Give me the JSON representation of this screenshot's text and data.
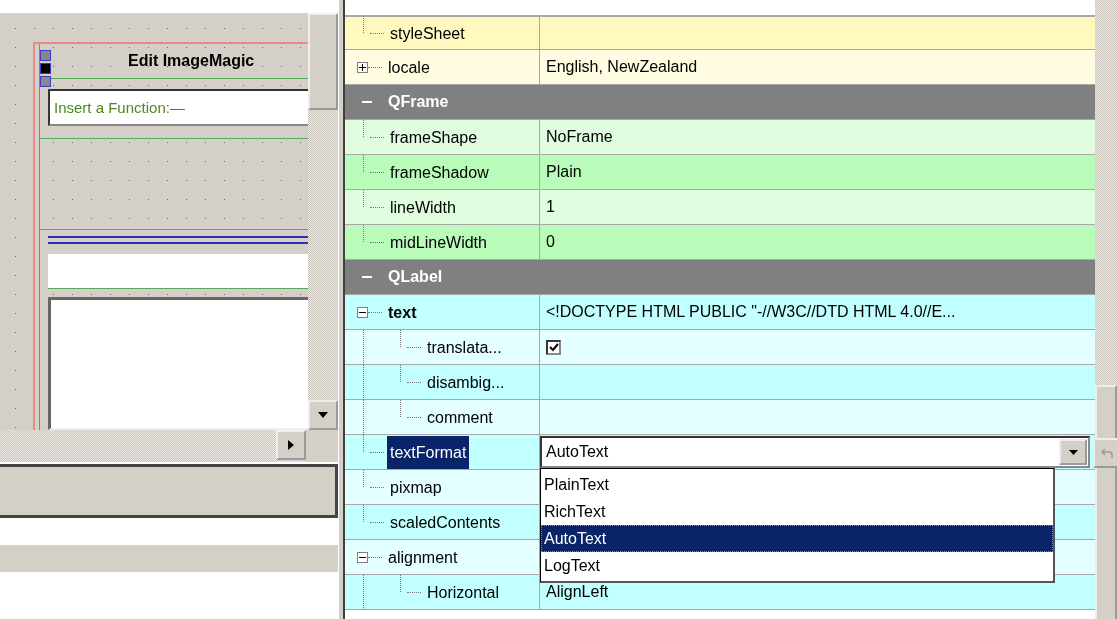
{
  "design_form": {
    "title": "Edit ImageMagic",
    "function_label": "Insert a Function:—"
  },
  "property_editor": {
    "groups": [
      {
        "color": "#fff8bf",
        "rows": [
          {
            "name": "styleSheet",
            "modified": false,
            "selected": false,
            "kind": "text"
          },
          {
            "name": "locale",
            "modified": false,
            "selected": false,
            "kind": "text",
            "value": "English, NewZealand",
            "expanded": false,
            "children": []
          }
        ]
      },
      {
        "title": "QFrame",
        "expanded": true,
        "color": "#b9fbb9",
        "rows": [
          {
            "name": "frameShape",
            "modified": false,
            "selected": false,
            "kind": "text",
            "value": "NoFrame"
          },
          {
            "name": "frameShadow",
            "modified": false,
            "selected": false,
            "kind": "text",
            "value": "Plain"
          },
          {
            "name": "lineWidth",
            "modified": false,
            "selected": false,
            "kind": "text",
            "value": "1"
          },
          {
            "name": "midLineWidth",
            "modified": false,
            "selected": false,
            "kind": "text",
            "value": "0"
          }
        ]
      },
      {
        "title": "QLabel",
        "expanded": true,
        "color": "#c2ffff",
        "rows": [
          {
            "name": "text",
            "modified": true,
            "selected": false,
            "kind": "text",
            "value": "<!DOCTYPE HTML PUBLIC \"-//W3C//DTD HTML 4.0//E...",
            "expanded": true,
            "children": [
              {
                "name": "translata...",
                "modified": false,
                "selected": false,
                "kind": "checkbox",
                "checked": true
              },
              {
                "name": "disambig...",
                "modified": false,
                "selected": false,
                "kind": "text"
              },
              {
                "name": "comment",
                "modified": false,
                "selected": false,
                "kind": "text"
              }
            ]
          },
          {
            "name": "textFormat",
            "modified": false,
            "selected": true,
            "kind": "combo",
            "value": "AutoText",
            "options": [
              {
                "label": "PlainText",
                "selected": false
              },
              {
                "label": "RichText",
                "selected": false
              },
              {
                "label": "AutoText",
                "selected": true
              },
              {
                "label": "LogText",
                "selected": false
              }
            ]
          },
          {
            "name": "pixmap",
            "modified": false,
            "selected": false,
            "kind": "text"
          },
          {
            "name": "scaledContents",
            "modified": false,
            "selected": false,
            "kind": "text"
          },
          {
            "name": "alignment",
            "modified": false,
            "selected": false,
            "kind": "text",
            "expanded": true,
            "children": [
              {
                "name": "Horizontal",
                "modified": false,
                "selected": false,
                "kind": "text",
                "value": "AlignLeft"
              }
            ]
          }
        ]
      }
    ]
  }
}
